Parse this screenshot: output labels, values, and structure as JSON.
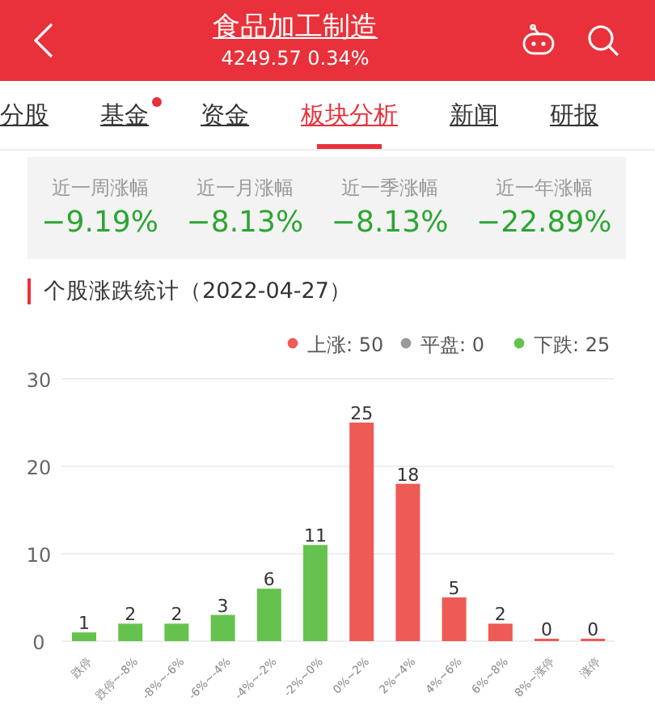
{
  "header": {
    "title": "食品加工制造",
    "subtitle": "4249.57 0.34%"
  },
  "tabs": [
    {
      "label": "分股",
      "selected": false,
      "dot": false
    },
    {
      "label": "基金",
      "selected": false,
      "dot": true
    },
    {
      "label": "资金",
      "selected": false,
      "dot": false
    },
    {
      "label": "板块分析",
      "selected": true,
      "dot": false
    },
    {
      "label": "新闻",
      "selected": false,
      "dot": false
    },
    {
      "label": "研报",
      "selected": false,
      "dot": false
    }
  ],
  "stats": [
    {
      "label": "近一周涨幅",
      "value": "−9.19%"
    },
    {
      "label": "近一月涨幅",
      "value": "−8.13%"
    },
    {
      "label": "近一季涨幅",
      "value": "−8.13%"
    },
    {
      "label": "近一年涨幅",
      "value": "−22.89%"
    }
  ],
  "section_title": "个股涨跌统计（2022-04-27）",
  "chart_data": {
    "type": "bar",
    "categories": [
      "跌停",
      "跌停~-8%",
      "-8%~-6%",
      "-6%~-4%",
      "-4%~-2%",
      "-2%~0%",
      "0%~2%",
      "2%~4%",
      "4%~6%",
      "6%~8%",
      "8%~涨停",
      "涨停"
    ],
    "series": [
      {
        "name": "上涨: 50",
        "color": "#ee5a55",
        "values": [
          null,
          null,
          null,
          null,
          null,
          null,
          25,
          18,
          5,
          2,
          0,
          0
        ]
      },
      {
        "name": "平盘: 0",
        "color": "#999999",
        "values": [
          null,
          null,
          null,
          null,
          null,
          null,
          null,
          null,
          null,
          null,
          null,
          null
        ]
      },
      {
        "name": "下跌: 25",
        "color": "#66c24f",
        "values": [
          1,
          2,
          2,
          3,
          6,
          11,
          null,
          null,
          null,
          null,
          null,
          null
        ]
      }
    ],
    "legend": "top-right",
    "ylim": [
      0,
      30
    ],
    "yticks": [
      0,
      10,
      20,
      30
    ],
    "data_labels": true
  }
}
